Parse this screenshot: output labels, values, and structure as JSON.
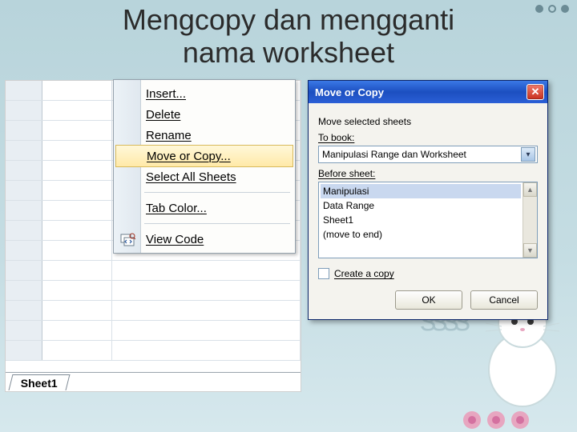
{
  "title": {
    "line1": "Mengcopy dan mengganti",
    "line2": "nama worksheet"
  },
  "sheet": {
    "tab_name": "Sheet1"
  },
  "context_menu": {
    "insert": "Insert...",
    "delete": "Delete",
    "rename": "Rename",
    "move_or_copy": "Move or Copy...",
    "select_all": "Select All Sheets",
    "tab_color": "Tab Color...",
    "view_code": "View Code"
  },
  "dialog": {
    "title": "Move or Copy",
    "label_move_selected": "Move selected sheets",
    "label_to_book": "To book:",
    "to_book_value": "Manipulasi Range dan Worksheet",
    "label_before_sheet": "Before sheet:",
    "before_sheet_items": [
      "Manipulasi",
      "Data Range",
      "Sheet1",
      "(move to end)"
    ],
    "create_copy": "Create a copy",
    "ok": "OK",
    "cancel": "Cancel"
  }
}
